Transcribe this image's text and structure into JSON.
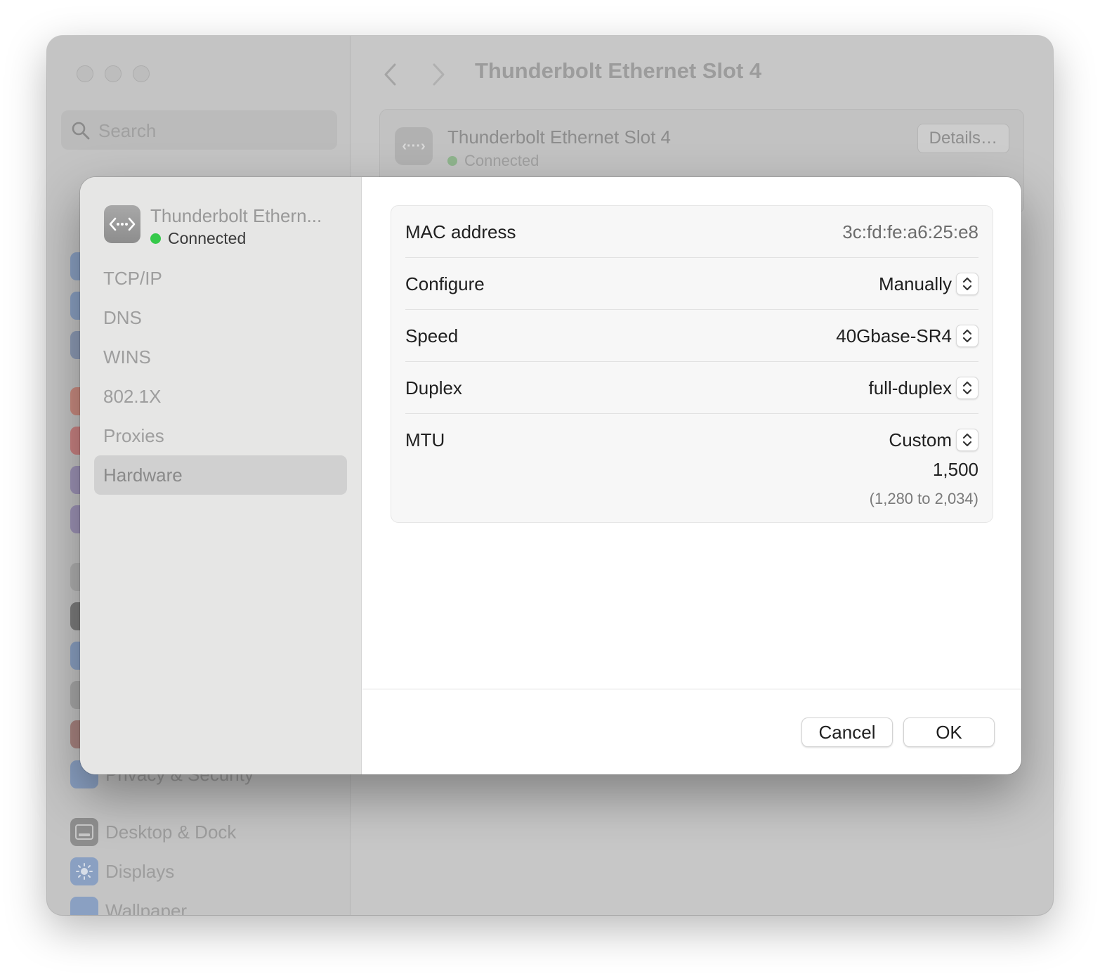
{
  "window": {
    "title": "Thunderbolt Ethernet Slot 4",
    "search_placeholder": "Search",
    "sidebar_visible": [
      {
        "label": "Privacy & Security",
        "icon": "hand-icon"
      },
      {
        "label": "Desktop & Dock",
        "icon": "dock-icon"
      },
      {
        "label": "Displays",
        "icon": "sun-icon"
      },
      {
        "label": "Wallpaper",
        "icon": "flower-icon"
      }
    ],
    "connection": {
      "name": "Thunderbolt Ethernet Slot 4",
      "status": "Connected",
      "details_label": "Details…"
    }
  },
  "sheet": {
    "interface": {
      "name": "Thunderbolt Ethern...",
      "status": "Connected",
      "status_color": "#35c94a"
    },
    "tabs": [
      {
        "label": "TCP/IP"
      },
      {
        "label": "DNS"
      },
      {
        "label": "WINS"
      },
      {
        "label": "802.1X"
      },
      {
        "label": "Proxies"
      },
      {
        "label": "Hardware",
        "selected": true
      }
    ],
    "hardware": {
      "mac_label": "MAC address",
      "mac_value": "3c:fd:fe:a6:25:e8",
      "configure_label": "Configure",
      "configure_value": "Manually",
      "speed_label": "Speed",
      "speed_value": "40Gbase-SR4",
      "duplex_label": "Duplex",
      "duplex_value": "full-duplex",
      "mtu_label": "MTU",
      "mtu_mode": "Custom",
      "mtu_value": "1,500",
      "mtu_range": "(1,280 to 2,034)"
    },
    "buttons": {
      "cancel": "Cancel",
      "ok": "OK"
    }
  }
}
